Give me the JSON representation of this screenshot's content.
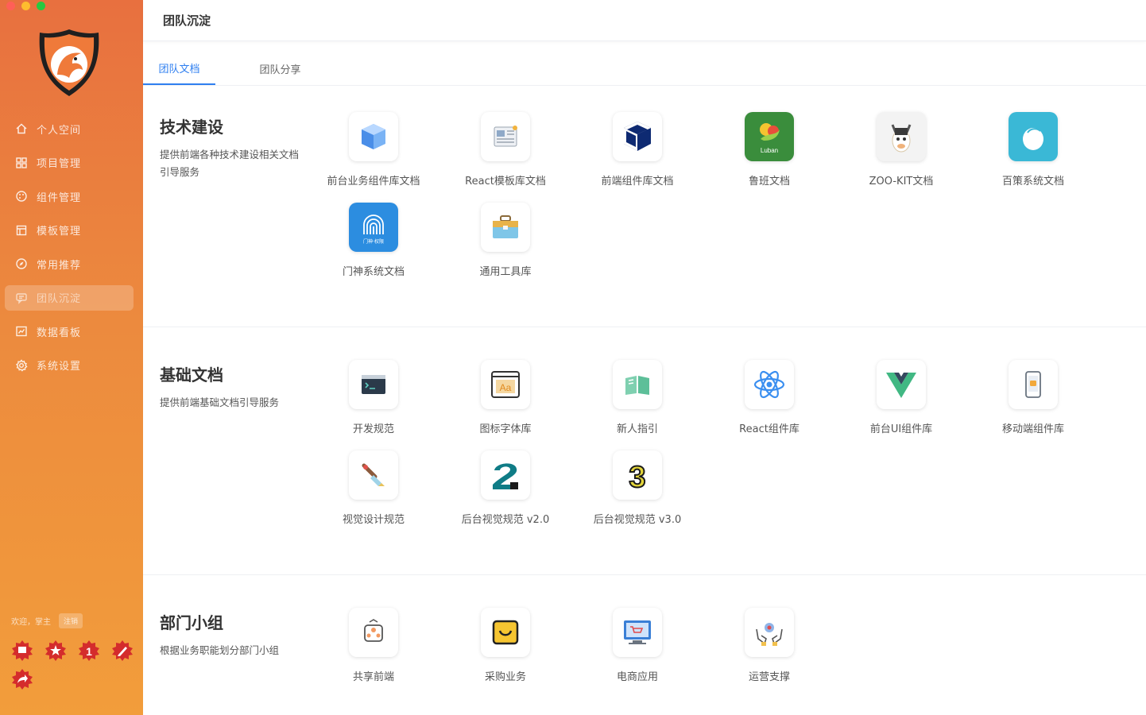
{
  "window": {
    "title": "团队沉淀"
  },
  "sidebar": {
    "items": [
      {
        "label": "个人空间",
        "icon": "home-icon"
      },
      {
        "label": "项目管理",
        "icon": "grid-icon"
      },
      {
        "label": "组件管理",
        "icon": "palette-icon"
      },
      {
        "label": "模板管理",
        "icon": "template-icon"
      },
      {
        "label": "常用推荐",
        "icon": "compass-icon"
      },
      {
        "label": "团队沉淀",
        "icon": "chat-icon",
        "active": true
      },
      {
        "label": "数据看板",
        "icon": "chart-icon"
      },
      {
        "label": "系统设置",
        "icon": "gear-icon"
      }
    ],
    "welcome": "欢迎，掌主",
    "logout": "注销",
    "badge_number": "1"
  },
  "tabs": [
    {
      "label": "团队文档",
      "active": true
    },
    {
      "label": "团队分享"
    }
  ],
  "sections": [
    {
      "title": "技术建设",
      "desc": "提供前端各种技术建设相关文档引导服务",
      "cards": [
        {
          "label": "前台业务组件库文档",
          "icon": "cube-icon"
        },
        {
          "label": "React模板库文档",
          "icon": "newspaper-icon"
        },
        {
          "label": "前端组件库文档",
          "icon": "dark-cube-icon"
        },
        {
          "label": "鲁班文档",
          "icon": "luban-logo-icon",
          "icon_text": "Luban"
        },
        {
          "label": "ZOO-KIT文档",
          "icon": "mascot-icon"
        },
        {
          "label": "百策系统文档",
          "icon": "egg-icon"
        },
        {
          "label": "门神系统文档",
          "icon": "fingerprint-icon",
          "icon_text": "门神·权限"
        },
        {
          "label": "通用工具库",
          "icon": "toolbox-icon"
        }
      ]
    },
    {
      "title": "基础文档",
      "desc": "提供前端基础文档引导服务",
      "cards": [
        {
          "label": "开发规范",
          "icon": "code-window-icon"
        },
        {
          "label": "图标字体库",
          "icon": "font-icon",
          "icon_text": "Aa"
        },
        {
          "label": "新人指引",
          "icon": "book-icon"
        },
        {
          "label": "React组件库",
          "icon": "react-icon"
        },
        {
          "label": "前台UI组件库",
          "icon": "vue-icon"
        },
        {
          "label": "移动端组件库",
          "icon": "phone-icon"
        },
        {
          "label": "视觉设计规范",
          "icon": "brush-icon"
        },
        {
          "label": "后台视觉规范 v2.0",
          "icon": "number-two-icon"
        },
        {
          "label": "后台视觉规范 v3.0",
          "icon": "number-three-icon",
          "icon_text": "3"
        }
      ]
    },
    {
      "title": "部门小组",
      "desc": "根据业务职能划分部门小组",
      "cards": [
        {
          "label": "共享前端",
          "icon": "share-icon"
        },
        {
          "label": "采购业务",
          "icon": "shopping-bag-icon"
        },
        {
          "label": "电商应用",
          "icon": "ecommerce-icon"
        },
        {
          "label": "运营支撑",
          "icon": "support-hands-icon"
        }
      ]
    }
  ],
  "colors": {
    "sidebar_top": "#e8703f",
    "sidebar_bottom": "#f29d3b",
    "accent": "#2f7ff0"
  }
}
